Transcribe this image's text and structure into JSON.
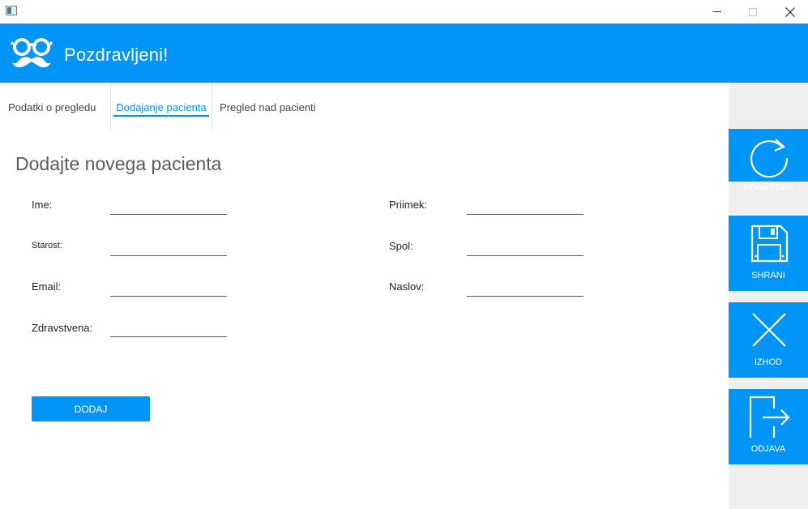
{
  "window": {
    "controls": [
      "minimize",
      "maximize",
      "close"
    ]
  },
  "header": {
    "title": "Pozdravljeni!",
    "logo_icon": "glasses-mustache-icon"
  },
  "tabs": [
    {
      "label": "Podatki o pregledu",
      "active": false
    },
    {
      "label": "Dodajanje pacienta",
      "active": true
    },
    {
      "label": "Pregled nad pacienti",
      "active": false
    }
  ],
  "form": {
    "title": "Dodajte novega pacienta",
    "fields": {
      "ime": {
        "label": "Ime:",
        "value": ""
      },
      "priimek": {
        "label": "Priimek:",
        "value": ""
      },
      "starost": {
        "label": "Starost:",
        "value": ""
      },
      "spol": {
        "label": "Spol:",
        "value": ""
      },
      "email": {
        "label": "Email:",
        "value": ""
      },
      "naslov": {
        "label": "Naslov:",
        "value": ""
      },
      "zdravstvena": {
        "label": "Zdravstvena:",
        "value": ""
      }
    },
    "submit_label": "DODAJ"
  },
  "sidebar": {
    "buttons": [
      {
        "label": "PONASTAVI",
        "icon": "refresh-icon"
      },
      {
        "label": "SHRANI",
        "icon": "floppy-disk-icon"
      },
      {
        "label": "IZHOD",
        "icon": "close-icon"
      },
      {
        "label": "ODJAVA",
        "icon": "logout-icon"
      }
    ]
  },
  "colors": {
    "accent": "#0095f6",
    "panel": "#efefef",
    "text": "#222222",
    "title_text": "#5b5b5b"
  }
}
